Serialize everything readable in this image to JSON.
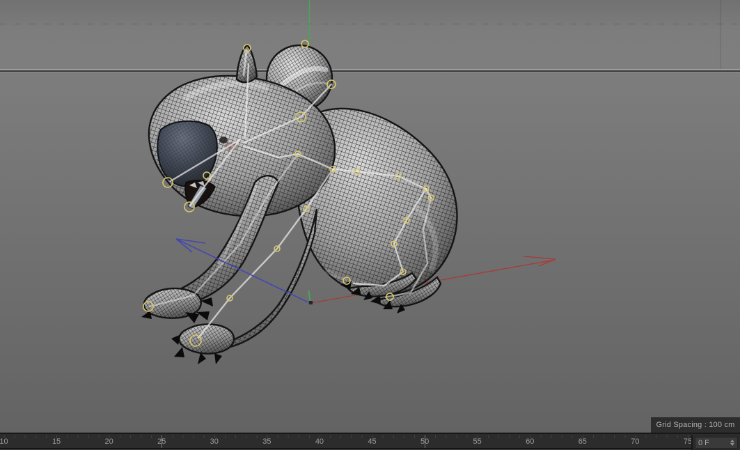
{
  "viewport": {
    "grid_spacing_label": "Grid Spacing : 100 cm",
    "model_subject": "rigged wireframe koala",
    "colors": {
      "axis_x": "#a83a36",
      "axis_y": "#4ba456",
      "axis_z": "#4145b4",
      "joint": "#d9c869",
      "bone": "#ececec",
      "horizon_line": "#9d9d9d"
    }
  },
  "timeline": {
    "frame_labels": [
      "10",
      "15",
      "20",
      "25",
      "30",
      "35",
      "40",
      "45",
      "50",
      "55",
      "60",
      "65",
      "70",
      "75"
    ],
    "marker_frames": [
      "25",
      "50"
    ],
    "current_frame_label": "0 F",
    "spinner_icon": "up-down-stepper"
  }
}
